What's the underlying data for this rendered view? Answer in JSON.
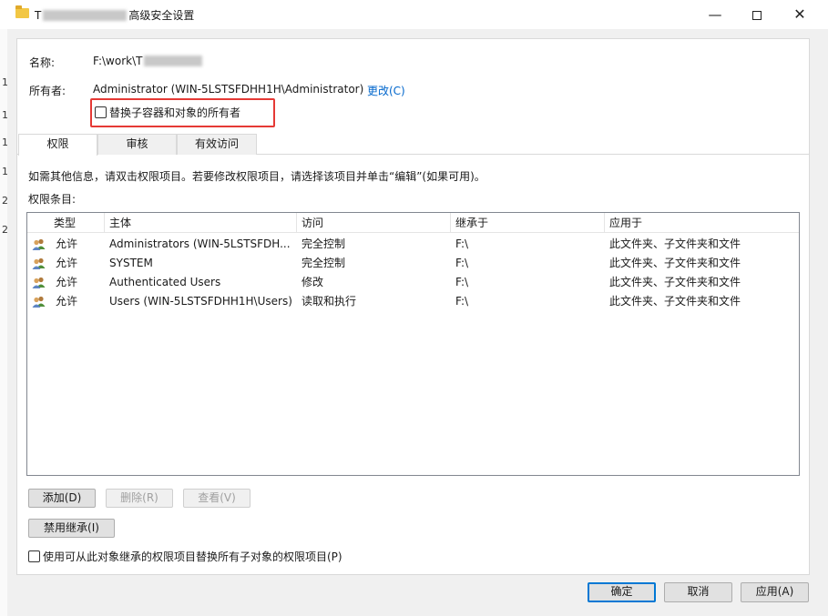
{
  "window": {
    "title_prefix": "T",
    "title_suffix": "高级安全设置"
  },
  "left_strip": [
    "1",
    "1",
    "1",
    "1",
    "2",
    "2"
  ],
  "info": {
    "name_label": "名称:",
    "name_value": "F:\\work\\T",
    "owner_label": "所有者:",
    "owner_value": "Administrator (WIN-5LSTSFDHH1H\\Administrator)",
    "change_link": "更改(C)",
    "replace_owner_checkbox": "替换子容器和对象的所有者"
  },
  "tabs": [
    "权限",
    "审核",
    "有效访问"
  ],
  "hint": "如需其他信息，请双击权限项目。若要修改权限项目，请选择该项目并单击“编辑”(如果可用)。",
  "entries_label": "权限条目:",
  "table": {
    "columns": [
      "类型",
      "主体",
      "访问",
      "继承于",
      "应用于"
    ],
    "rows": [
      {
        "type": "允许",
        "principal": "Administrators (WIN-5LSTSFDH...",
        "access": "完全控制",
        "inherited": "F:\\",
        "applies": "此文件夹、子文件夹和文件"
      },
      {
        "type": "允许",
        "principal": "SYSTEM",
        "access": "完全控制",
        "inherited": "F:\\",
        "applies": "此文件夹、子文件夹和文件"
      },
      {
        "type": "允许",
        "principal": "Authenticated Users",
        "access": "修改",
        "inherited": "F:\\",
        "applies": "此文件夹、子文件夹和文件"
      },
      {
        "type": "允许",
        "principal": "Users (WIN-5LSTSFDHH1H\\Users)",
        "access": "读取和执行",
        "inherited": "F:\\",
        "applies": "此文件夹、子文件夹和文件"
      }
    ]
  },
  "buttons": {
    "add": "添加(D)",
    "remove": "删除(R)",
    "view": "查看(V)",
    "disable_inheritance": "禁用继承(I)",
    "ok": "确定",
    "cancel": "取消",
    "apply": "应用(A)"
  },
  "replace_child_checkbox": "使用可从此对象继承的权限项目替换所有子对象的权限项目(P)",
  "colors": {
    "highlight": "#e53935",
    "link": "#0066cc",
    "focus": "#0078d4",
    "folder": "#f2c744"
  }
}
